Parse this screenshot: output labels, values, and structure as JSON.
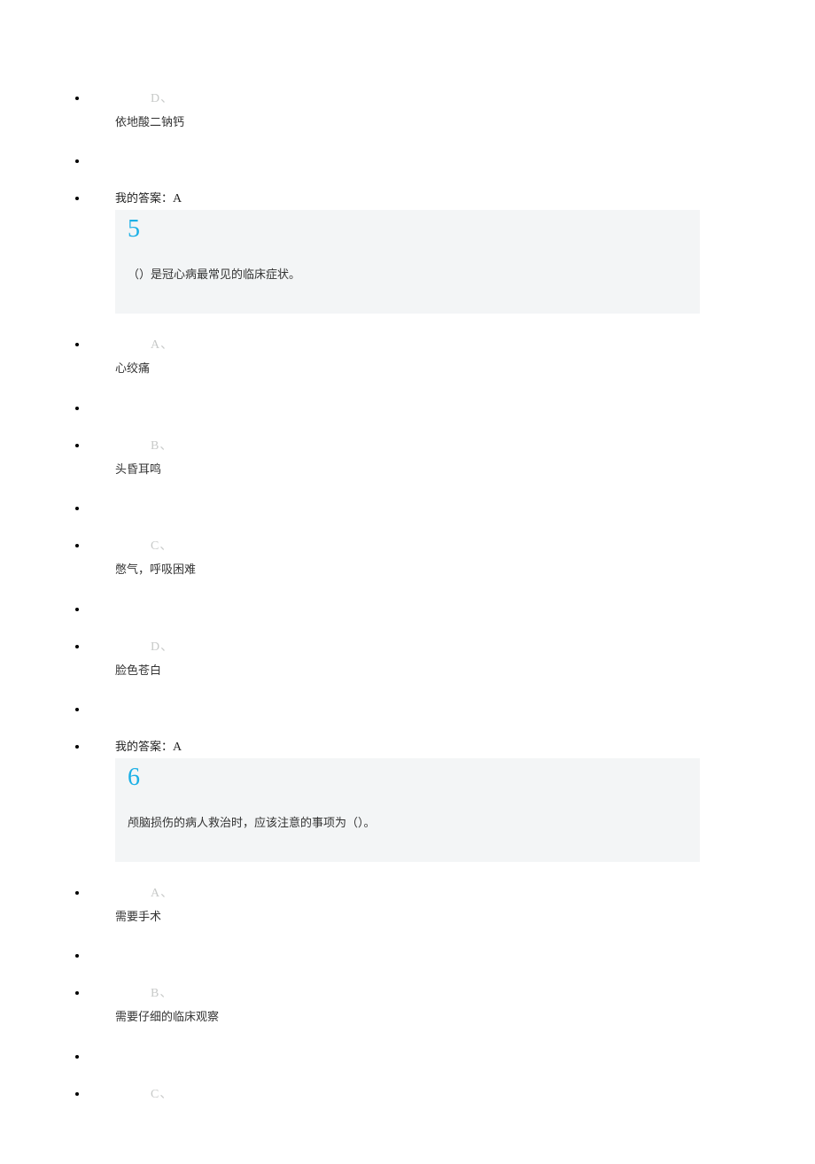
{
  "items": [
    {
      "kind": "option",
      "letter": "D、",
      "text": "依地酸二钠钙"
    },
    {
      "kind": "empty"
    },
    {
      "kind": "answer_q",
      "answer_label": "我的答案：",
      "answer_value": "A",
      "number": "5",
      "question": "（）是冠心病最常见的临床症状。"
    },
    {
      "kind": "option",
      "letter": "A、",
      "text": "心绞痛"
    },
    {
      "kind": "empty"
    },
    {
      "kind": "option",
      "letter": "B、",
      "text": "头昏耳鸣"
    },
    {
      "kind": "empty"
    },
    {
      "kind": "option",
      "letter": "C、",
      "text": "憋气，呼吸困难"
    },
    {
      "kind": "empty"
    },
    {
      "kind": "option",
      "letter": "D、",
      "text": "脸色苍白"
    },
    {
      "kind": "empty"
    },
    {
      "kind": "answer_q",
      "answer_label": "我的答案：",
      "answer_value": "A",
      "number": "6",
      "question": "颅脑损伤的病人救治时，应该注意的事项为（）。"
    },
    {
      "kind": "option",
      "letter": "A、",
      "text": "需要手术"
    },
    {
      "kind": "empty"
    },
    {
      "kind": "option",
      "letter": "B、",
      "text": "需要仔细的临床观察"
    },
    {
      "kind": "empty"
    },
    {
      "kind": "option_only_letter",
      "letter": "C、"
    }
  ]
}
